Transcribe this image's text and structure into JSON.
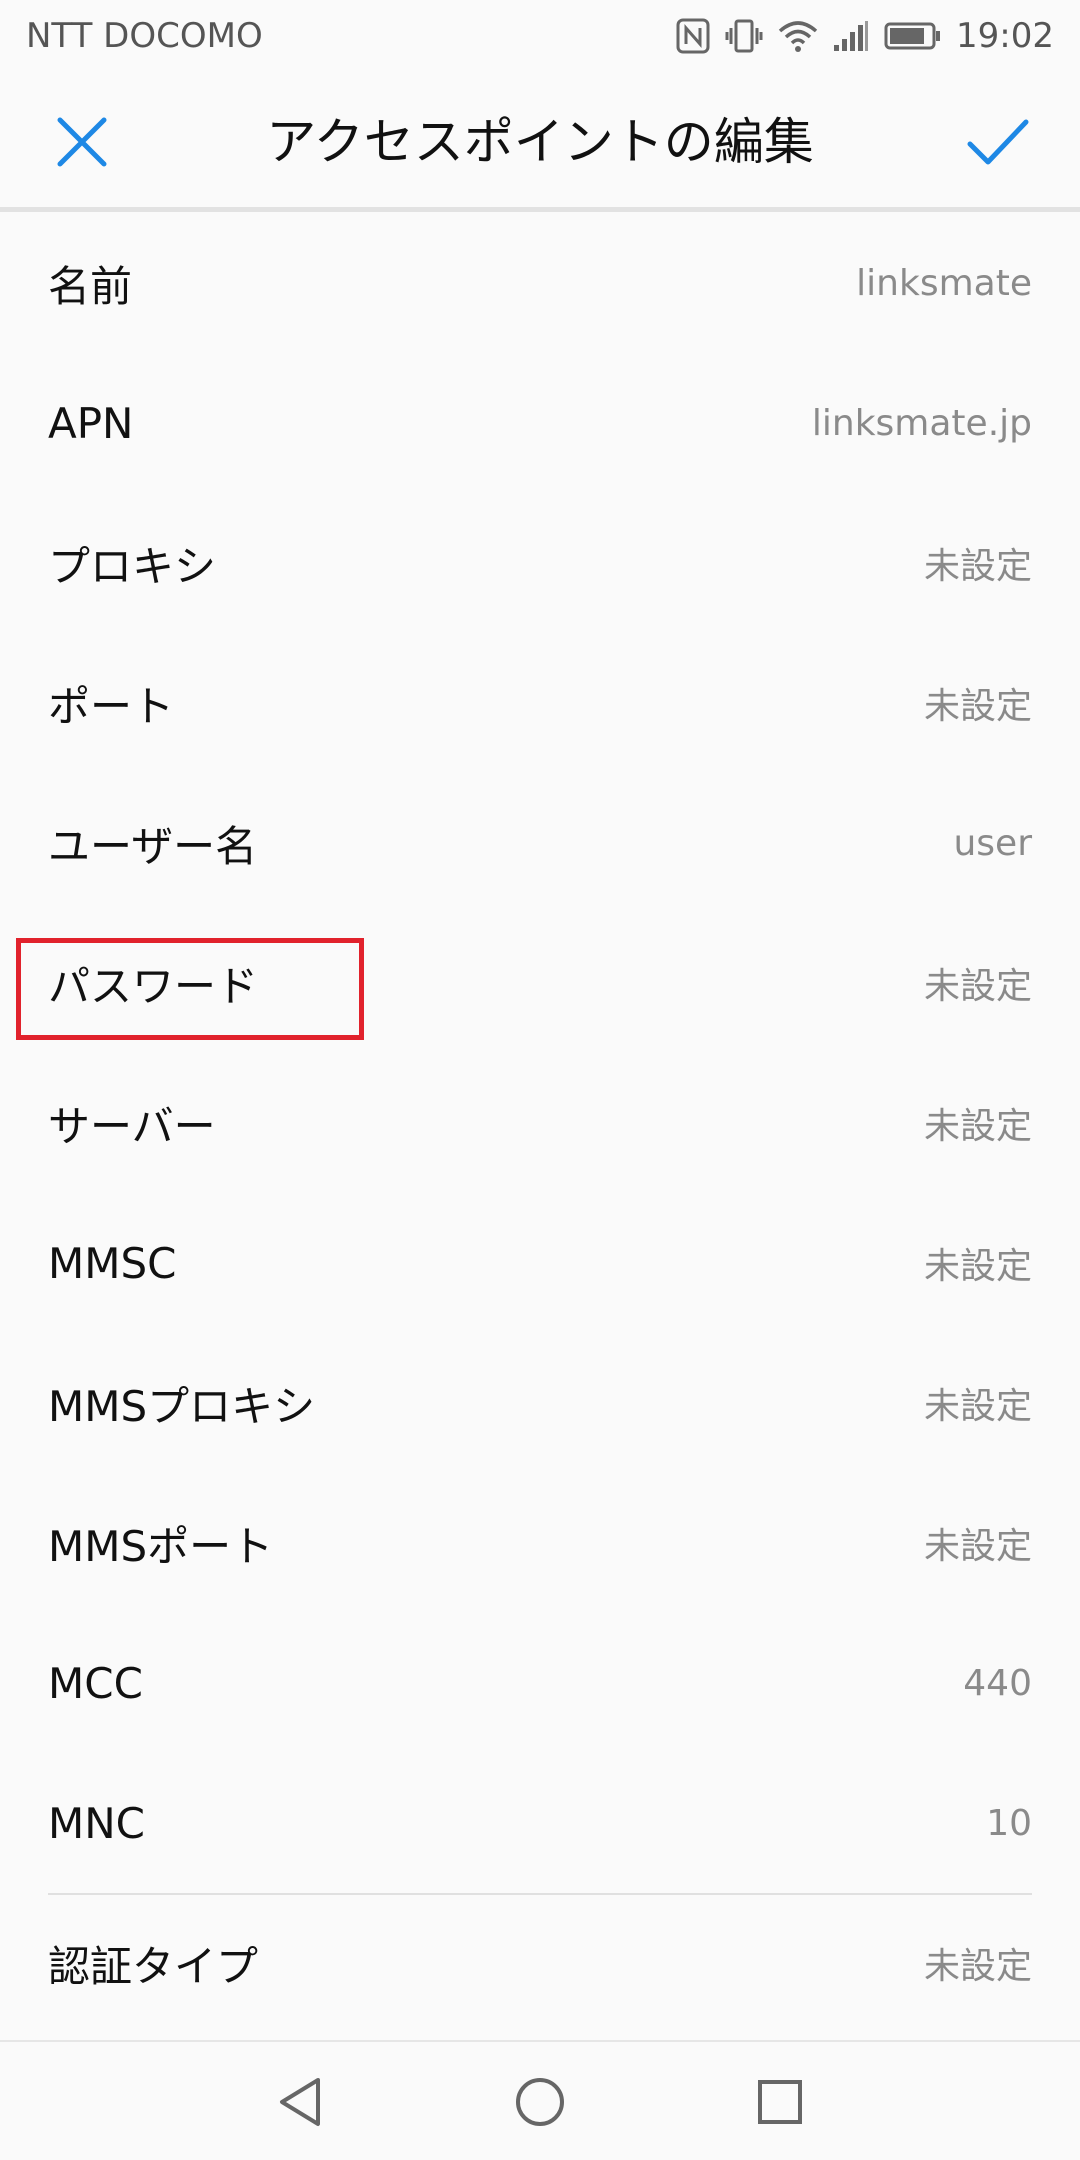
{
  "status_bar": {
    "carrier": "NTT DOCOMO",
    "time": "19:02",
    "icons": [
      "nfc-icon",
      "vibrate-icon",
      "wifi-icon",
      "signal-icon",
      "battery-icon"
    ]
  },
  "app_bar": {
    "title": "アクセスポイントの編集",
    "close_icon": "close-icon",
    "confirm_icon": "check-icon",
    "accent_color": "#1e88e5"
  },
  "settings": [
    {
      "label": "名前",
      "value": "linksmate"
    },
    {
      "label": "APN",
      "value": "linksmate.jp"
    },
    {
      "label": "プロキシ",
      "value": "未設定"
    },
    {
      "label": "ポート",
      "value": "未設定"
    },
    {
      "label": "ユーザー名",
      "value": "user"
    },
    {
      "label": "パスワード",
      "value": "未設定"
    },
    {
      "label": "サーバー",
      "value": "未設定"
    },
    {
      "label": "MMSC",
      "value": "未設定"
    },
    {
      "label": "MMSプロキシ",
      "value": "未設定"
    },
    {
      "label": "MMSポート",
      "value": "未設定"
    },
    {
      "label": "MCC",
      "value": "440"
    },
    {
      "label": "MNC",
      "value": "10"
    },
    {
      "label": "認証タイプ",
      "value": "未設定"
    }
  ],
  "highlight": {
    "target": "パスワード",
    "color": "#e1222c"
  },
  "nav_bar": {
    "icons": [
      "back-icon",
      "home-icon",
      "recents-icon"
    ]
  }
}
